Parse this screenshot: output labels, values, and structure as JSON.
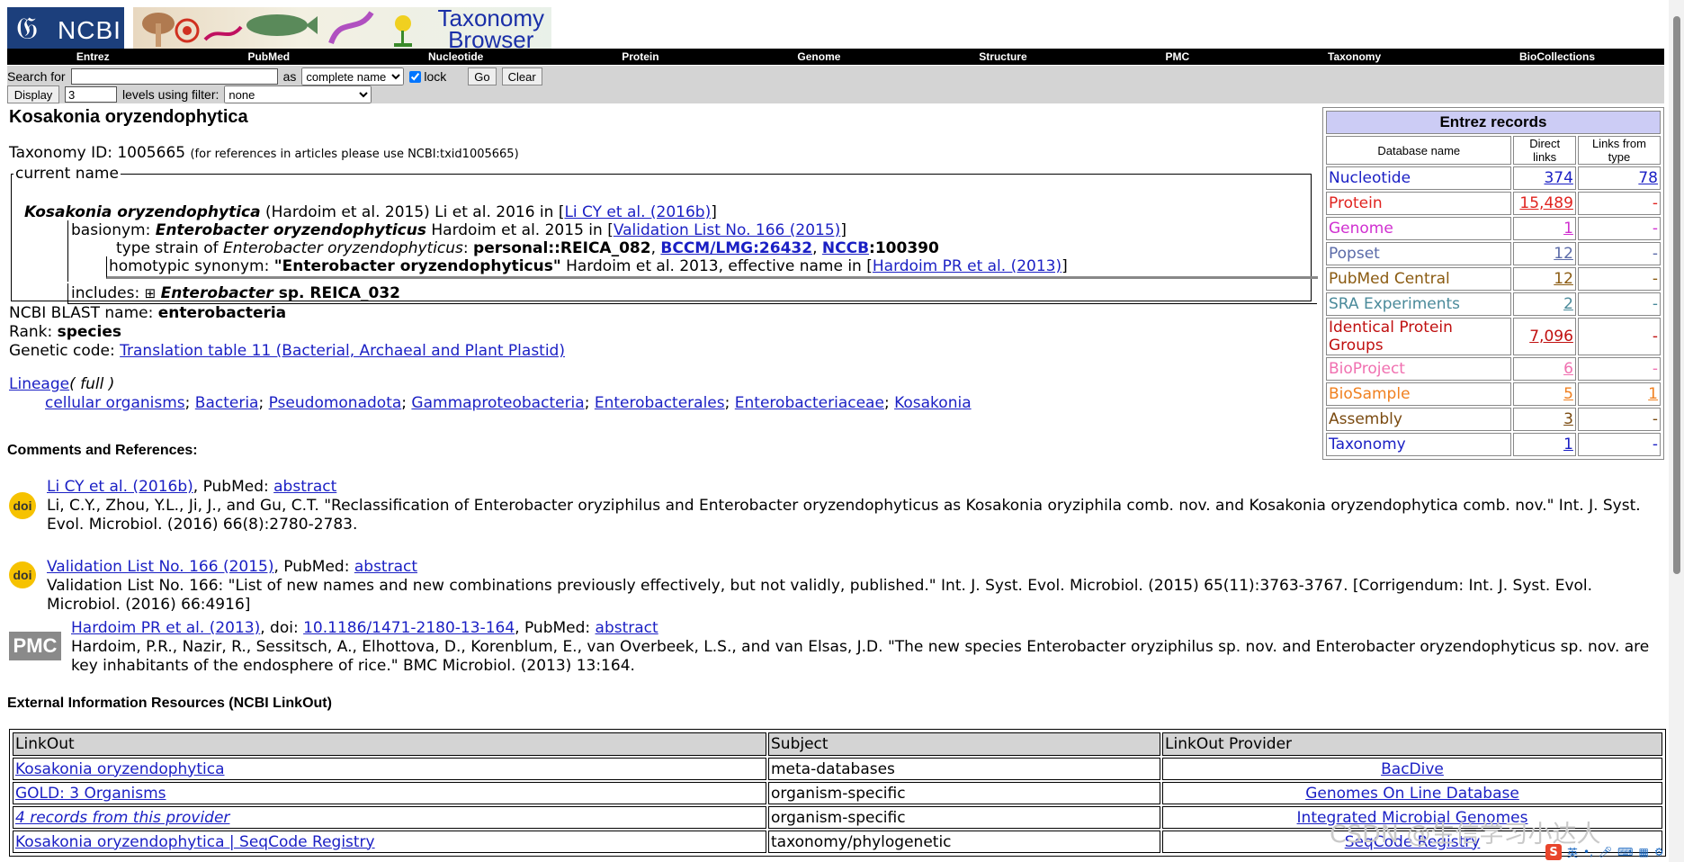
{
  "header": {
    "logo_text": "NCBI",
    "banner_title_line1": "Taxonomy",
    "banner_title_line2": "Browser",
    "nav": [
      "Entrez",
      "PubMed",
      "Nucleotide",
      "Protein",
      "Genome",
      "Structure",
      "PMC",
      "Taxonomy",
      "BioCollections"
    ]
  },
  "search": {
    "label": "Search for",
    "input_value": "",
    "as_label": "as",
    "as_value": "complete name",
    "lock_label": "lock",
    "lock_checked": true,
    "go_label": "Go",
    "clear_label": "Clear",
    "display_label": "Display",
    "levels_value": "3",
    "levels_label": "levels using filter:",
    "filter_value": "none"
  },
  "main": {
    "title": "Kosakonia oryzendophytica",
    "taxid_prefix": "Taxonomy ID: 1005665",
    "taxid_note": "(for references in articles please use NCBI:txid1005665)",
    "current_name_legend": "current name",
    "current": {
      "name": "Kosakonia oryzendophytica",
      "author": " (Hardoim et al. 2015) Li et al. 2016 in [",
      "ref": "Li CY et al. (2016b)",
      "close": "]"
    },
    "basionym": {
      "label": "basionym: ",
      "name": "Enterobacter oryzendophyticus",
      "author": " Hardoim et al. 2015 in [",
      "ref": "Validation List No. 166 (2015)",
      "close": "]"
    },
    "type_strain": {
      "label": "type strain of ",
      "name": "Enterobacter oryzendophyticus",
      "colon": ": ",
      "s1": "personal::REICA_082",
      "sep1": ", ",
      "s2": "BCCM/LMG:26432",
      "sep2": ", ",
      "s3": "NCCB",
      "s3b": ":100390"
    },
    "homotypic": {
      "label": "homotypic synonym: ",
      "name": "\"Enterobacter oryzendophyticus\"",
      "author": " Hardoim et al. 2013, effective name in [",
      "ref": "Hardoim PR et al. (2013)",
      "close": "]"
    },
    "includes": {
      "label": "includes: ",
      "genus": "Enterobacter",
      "rest": " sp. REICA_032"
    },
    "blast_label": "NCBI BLAST name: ",
    "blast_value": "enterobacteria",
    "rank_label": "Rank: ",
    "rank_value": "species",
    "genetic_label": "Genetic code: ",
    "genetic_value": "Translation table 11 (Bacterial, Archaeal and Plant Plastid)",
    "lineage_label": "Lineage",
    "lineage_full": "( full )",
    "lineage": [
      "cellular organisms",
      "Bacteria",
      "Pseudomonadota",
      "Gammaproteobacteria",
      "Enterobacterales",
      "Enterobacteriaceae",
      "Kosakonia"
    ]
  },
  "comments": {
    "heading": "Comments and References:",
    "refs": [
      {
        "icon": "doi",
        "link": "Li CY et al. (2016b)",
        "mid": ", PubMed: ",
        "abstract": "abstract",
        "text": "Li, C.Y., Zhou, Y.L., Ji, J., and Gu, C.T. \"Reclassification of Enterobacter oryziphilus and Enterobacter oryzendophyticus as Kosakonia oryziphila comb. nov. and Kosakonia oryzendophytica comb. nov.\" Int. J. Syst. Evol. Microbiol. (2016) 66(8):2780-2783."
      },
      {
        "icon": "doi",
        "link": "Validation List No. 166 (2015)",
        "mid": ", PubMed: ",
        "abstract": "abstract",
        "text": "Validation List No. 166: \"List of new names and new combinations previously effectively, but not validly, published.\" Int. J. Syst. Evol. Microbiol. (2015) 65(11):3763-3767. [Corrigendum: Int. J. Syst. Evol. Microbiol. (2016) 66:4916]"
      },
      {
        "icon": "PMC",
        "link": "Hardoim PR et al. (2013)",
        "mid": ", doi: ",
        "doi": "10.1186/1471-2180-13-164",
        "mid2": ", PubMed: ",
        "abstract": "abstract",
        "text": "Hardoim, P.R., Nazir, R., Sessitsch, A., Elhottova, D., Korenblum, E., van Overbeek, L.S., and van Elsas, J.D. \"The new species Enterobacter oryziphilus sp. nov. and Enterobacter oryzendophyticus sp. nov. are key inhabitants of the endosphere of rice.\" BMC Microbiol. (2013) 13:164."
      }
    ]
  },
  "entrez": {
    "title": "Entrez records",
    "col_db": "Database name",
    "col_direct": "Direct links",
    "col_from": "Links from type",
    "rows": [
      {
        "name": "Nucleotide",
        "direct": "374",
        "from": "78",
        "color": "#1a1fc4"
      },
      {
        "name": "Protein",
        "direct": "15,489",
        "from": "-",
        "color": "#e0231f"
      },
      {
        "name": "Genome",
        "direct": "1",
        "from": "-",
        "color": "#d030d0"
      },
      {
        "name": "Popset",
        "direct": "12",
        "from": "-",
        "color": "#5a6aa8"
      },
      {
        "name": "PubMed Central",
        "direct": "12",
        "from": "-",
        "color": "#8a5a10"
      },
      {
        "name": "SRA Experiments",
        "direct": "2",
        "from": "-",
        "color": "#4a8a9a"
      },
      {
        "name": "Identical Protein Groups",
        "direct": "7,096",
        "from": "-",
        "color": "#c01010"
      },
      {
        "name": "BioProject",
        "direct": "6",
        "from": "-",
        "color": "#f070b0"
      },
      {
        "name": "BioSample",
        "direct": "5",
        "from": "1",
        "color": "#f08020"
      },
      {
        "name": "Assembly",
        "direct": "3",
        "from": "-",
        "color": "#7a4a10"
      },
      {
        "name": "Taxonomy",
        "direct": "1",
        "from": "-",
        "color": "#1a1fc4"
      }
    ]
  },
  "linkout": {
    "heading": "External Information Resources (NCBI LinkOut)",
    "col_link": "LinkOut",
    "col_subject": "Subject",
    "col_provider": "LinkOut Provider",
    "rows": [
      {
        "link": "Kosakonia oryzendophytica",
        "italic": false,
        "subject": "meta-databases",
        "provider": "BacDive"
      },
      {
        "link": "GOLD: 3 Organisms",
        "italic": false,
        "subject": "organism-specific",
        "provider": "Genomes On Line Database"
      },
      {
        "link": "4 records from this provider",
        "italic": true,
        "subject": "organism-specific",
        "provider": "Integrated Microbial Genomes"
      },
      {
        "link": "Kosakonia oryzendophytica | SeqCode Registry",
        "italic": false,
        "subject": "taxonomy/phylogenetic",
        "provider": "SeqCode Registry"
      }
    ]
  },
  "overlay": {
    "watermark": "CSDN @生信学习小达人",
    "tray_s": "S",
    "tray_lang": "英"
  }
}
